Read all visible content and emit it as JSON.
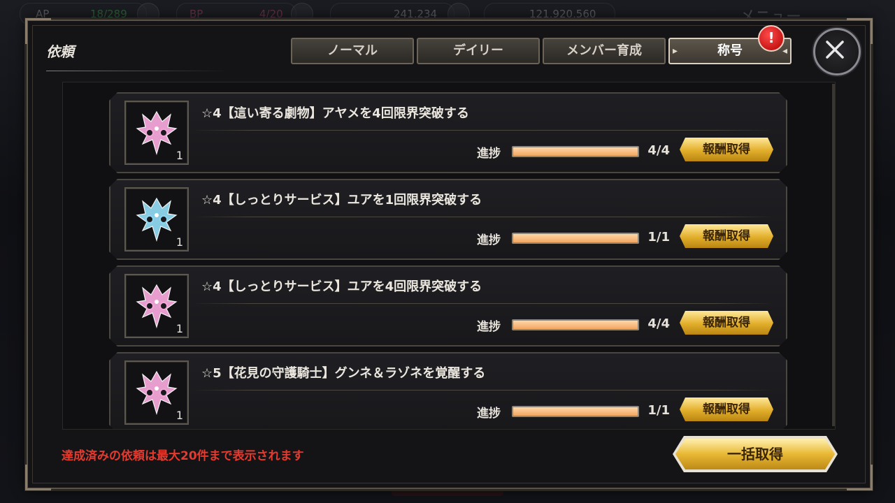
{
  "hud": {
    "ap_label": "AP",
    "ap_value": "18/289",
    "bp_label": "BP",
    "bp_value": "4/20",
    "currency1": "241,234",
    "currency2": "121,920,560",
    "menu_label": "メニュー"
  },
  "panel": {
    "title": "依頼",
    "tabs": [
      {
        "label": "ノーマル",
        "active": false
      },
      {
        "label": "デイリー",
        "active": false
      },
      {
        "label": "メンバー育成",
        "active": false
      },
      {
        "label": "称号",
        "active": true
      }
    ],
    "alert_badge": "!",
    "close_icon": "close-icon"
  },
  "quests": [
    {
      "title": "☆4【這い寄る劇物】アヤメを4回限界突破する",
      "icon_count": "1",
      "icon_color": "#f3a6d8",
      "progress_label": "進捗",
      "progress": "4/4",
      "progress_fraction": 1.0,
      "button": "報酬取得"
    },
    {
      "title": "☆4【しっとりサービス】ユアを1回限界突破する",
      "icon_count": "1",
      "icon_color": "#8fd6f0",
      "progress_label": "進捗",
      "progress": "1/1",
      "progress_fraction": 1.0,
      "button": "報酬取得"
    },
    {
      "title": "☆4【しっとりサービス】ユアを4回限界突破する",
      "icon_count": "1",
      "icon_color": "#f3a6d8",
      "progress_label": "進捗",
      "progress": "4/4",
      "progress_fraction": 1.0,
      "button": "報酬取得"
    },
    {
      "title": "☆5【花見の守護騎士】グンネ＆ラゾネを覚醒する",
      "icon_count": "1",
      "icon_color": "#f3a6d8",
      "progress_label": "進捗",
      "progress": "1/1",
      "progress_fraction": 1.0,
      "button": "報酬取得"
    }
  ],
  "footer": {
    "note": "達成済みの依頼は最大20件まで表示されます",
    "collect_all": "一括取得"
  }
}
